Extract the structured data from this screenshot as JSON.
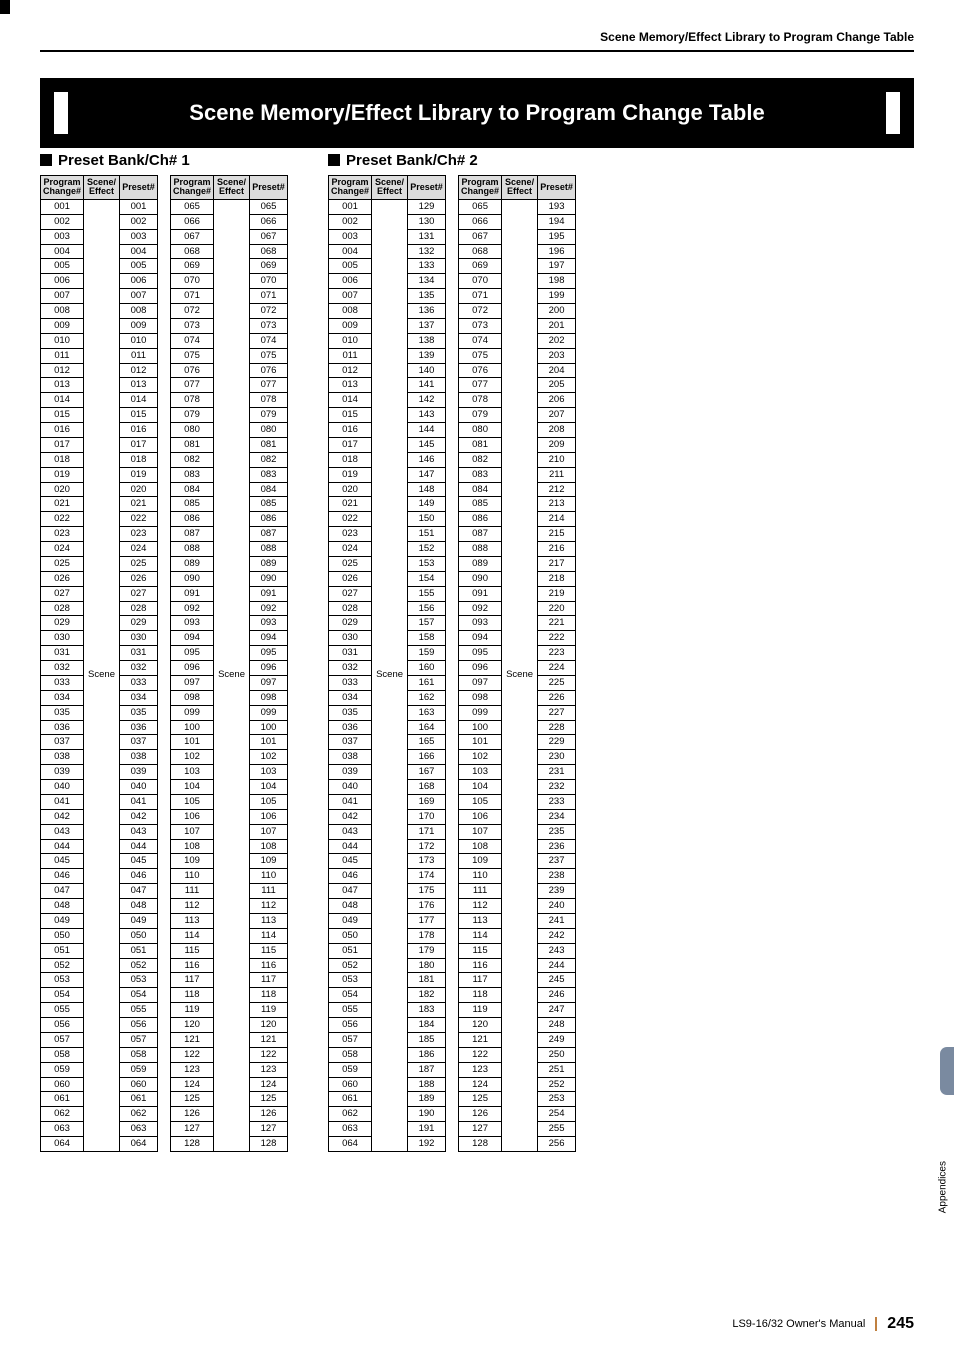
{
  "running_head": "Scene Memory/Effect Library to Program Change Table",
  "title": "Scene Memory/Effect Library to Program Change Table",
  "scene_label": "Scene",
  "headers": {
    "program_change": [
      "Program",
      "Change#"
    ],
    "scene_effect": [
      "Scene/",
      "Effect"
    ],
    "preset": "Preset#"
  },
  "bank1": {
    "heading": "Preset Bank/Ch# 1",
    "tableA": {
      "rows": [
        {
          "pc": "001",
          "preset": "001"
        },
        {
          "pc": "002",
          "preset": "002"
        },
        {
          "pc": "003",
          "preset": "003"
        },
        {
          "pc": "004",
          "preset": "004"
        },
        {
          "pc": "005",
          "preset": "005"
        },
        {
          "pc": "006",
          "preset": "006"
        },
        {
          "pc": "007",
          "preset": "007"
        },
        {
          "pc": "008",
          "preset": "008"
        },
        {
          "pc": "009",
          "preset": "009"
        },
        {
          "pc": "010",
          "preset": "010"
        },
        {
          "pc": "011",
          "preset": "011"
        },
        {
          "pc": "012",
          "preset": "012"
        },
        {
          "pc": "013",
          "preset": "013"
        },
        {
          "pc": "014",
          "preset": "014"
        },
        {
          "pc": "015",
          "preset": "015"
        },
        {
          "pc": "016",
          "preset": "016"
        },
        {
          "pc": "017",
          "preset": "017"
        },
        {
          "pc": "018",
          "preset": "018"
        },
        {
          "pc": "019",
          "preset": "019"
        },
        {
          "pc": "020",
          "preset": "020"
        },
        {
          "pc": "021",
          "preset": "021"
        },
        {
          "pc": "022",
          "preset": "022"
        },
        {
          "pc": "023",
          "preset": "023"
        },
        {
          "pc": "024",
          "preset": "024"
        },
        {
          "pc": "025",
          "preset": "025"
        },
        {
          "pc": "026",
          "preset": "026"
        },
        {
          "pc": "027",
          "preset": "027"
        },
        {
          "pc": "028",
          "preset": "028"
        },
        {
          "pc": "029",
          "preset": "029"
        },
        {
          "pc": "030",
          "preset": "030"
        },
        {
          "pc": "031",
          "preset": "031"
        },
        {
          "pc": "032",
          "preset": "032"
        },
        {
          "pc": "033",
          "preset": "033"
        },
        {
          "pc": "034",
          "preset": "034"
        },
        {
          "pc": "035",
          "preset": "035"
        },
        {
          "pc": "036",
          "preset": "036"
        },
        {
          "pc": "037",
          "preset": "037"
        },
        {
          "pc": "038",
          "preset": "038"
        },
        {
          "pc": "039",
          "preset": "039"
        },
        {
          "pc": "040",
          "preset": "040"
        },
        {
          "pc": "041",
          "preset": "041"
        },
        {
          "pc": "042",
          "preset": "042"
        },
        {
          "pc": "043",
          "preset": "043"
        },
        {
          "pc": "044",
          "preset": "044"
        },
        {
          "pc": "045",
          "preset": "045"
        },
        {
          "pc": "046",
          "preset": "046"
        },
        {
          "pc": "047",
          "preset": "047"
        },
        {
          "pc": "048",
          "preset": "048"
        },
        {
          "pc": "049",
          "preset": "049"
        },
        {
          "pc": "050",
          "preset": "050"
        },
        {
          "pc": "051",
          "preset": "051"
        },
        {
          "pc": "052",
          "preset": "052"
        },
        {
          "pc": "053",
          "preset": "053"
        },
        {
          "pc": "054",
          "preset": "054"
        },
        {
          "pc": "055",
          "preset": "055"
        },
        {
          "pc": "056",
          "preset": "056"
        },
        {
          "pc": "057",
          "preset": "057"
        },
        {
          "pc": "058",
          "preset": "058"
        },
        {
          "pc": "059",
          "preset": "059"
        },
        {
          "pc": "060",
          "preset": "060"
        },
        {
          "pc": "061",
          "preset": "061"
        },
        {
          "pc": "062",
          "preset": "062"
        },
        {
          "pc": "063",
          "preset": "063"
        },
        {
          "pc": "064",
          "preset": "064"
        }
      ]
    },
    "tableB": {
      "rows": [
        {
          "pc": "065",
          "preset": "065"
        },
        {
          "pc": "066",
          "preset": "066"
        },
        {
          "pc": "067",
          "preset": "067"
        },
        {
          "pc": "068",
          "preset": "068"
        },
        {
          "pc": "069",
          "preset": "069"
        },
        {
          "pc": "070",
          "preset": "070"
        },
        {
          "pc": "071",
          "preset": "071"
        },
        {
          "pc": "072",
          "preset": "072"
        },
        {
          "pc": "073",
          "preset": "073"
        },
        {
          "pc": "074",
          "preset": "074"
        },
        {
          "pc": "075",
          "preset": "075"
        },
        {
          "pc": "076",
          "preset": "076"
        },
        {
          "pc": "077",
          "preset": "077"
        },
        {
          "pc": "078",
          "preset": "078"
        },
        {
          "pc": "079",
          "preset": "079"
        },
        {
          "pc": "080",
          "preset": "080"
        },
        {
          "pc": "081",
          "preset": "081"
        },
        {
          "pc": "082",
          "preset": "082"
        },
        {
          "pc": "083",
          "preset": "083"
        },
        {
          "pc": "084",
          "preset": "084"
        },
        {
          "pc": "085",
          "preset": "085"
        },
        {
          "pc": "086",
          "preset": "086"
        },
        {
          "pc": "087",
          "preset": "087"
        },
        {
          "pc": "088",
          "preset": "088"
        },
        {
          "pc": "089",
          "preset": "089"
        },
        {
          "pc": "090",
          "preset": "090"
        },
        {
          "pc": "091",
          "preset": "091"
        },
        {
          "pc": "092",
          "preset": "092"
        },
        {
          "pc": "093",
          "preset": "093"
        },
        {
          "pc": "094",
          "preset": "094"
        },
        {
          "pc": "095",
          "preset": "095"
        },
        {
          "pc": "096",
          "preset": "096"
        },
        {
          "pc": "097",
          "preset": "097"
        },
        {
          "pc": "098",
          "preset": "098"
        },
        {
          "pc": "099",
          "preset": "099"
        },
        {
          "pc": "100",
          "preset": "100"
        },
        {
          "pc": "101",
          "preset": "101"
        },
        {
          "pc": "102",
          "preset": "102"
        },
        {
          "pc": "103",
          "preset": "103"
        },
        {
          "pc": "104",
          "preset": "104"
        },
        {
          "pc": "105",
          "preset": "105"
        },
        {
          "pc": "106",
          "preset": "106"
        },
        {
          "pc": "107",
          "preset": "107"
        },
        {
          "pc": "108",
          "preset": "108"
        },
        {
          "pc": "109",
          "preset": "109"
        },
        {
          "pc": "110",
          "preset": "110"
        },
        {
          "pc": "111",
          "preset": "111"
        },
        {
          "pc": "112",
          "preset": "112"
        },
        {
          "pc": "113",
          "preset": "113"
        },
        {
          "pc": "114",
          "preset": "114"
        },
        {
          "pc": "115",
          "preset": "115"
        },
        {
          "pc": "116",
          "preset": "116"
        },
        {
          "pc": "117",
          "preset": "117"
        },
        {
          "pc": "118",
          "preset": "118"
        },
        {
          "pc": "119",
          "preset": "119"
        },
        {
          "pc": "120",
          "preset": "120"
        },
        {
          "pc": "121",
          "preset": "121"
        },
        {
          "pc": "122",
          "preset": "122"
        },
        {
          "pc": "123",
          "preset": "123"
        },
        {
          "pc": "124",
          "preset": "124"
        },
        {
          "pc": "125",
          "preset": "125"
        },
        {
          "pc": "126",
          "preset": "126"
        },
        {
          "pc": "127",
          "preset": "127"
        },
        {
          "pc": "128",
          "preset": "128"
        }
      ]
    }
  },
  "bank2": {
    "heading": "Preset Bank/Ch# 2",
    "tableA": {
      "rows": [
        {
          "pc": "001",
          "preset": "129"
        },
        {
          "pc": "002",
          "preset": "130"
        },
        {
          "pc": "003",
          "preset": "131"
        },
        {
          "pc": "004",
          "preset": "132"
        },
        {
          "pc": "005",
          "preset": "133"
        },
        {
          "pc": "006",
          "preset": "134"
        },
        {
          "pc": "007",
          "preset": "135"
        },
        {
          "pc": "008",
          "preset": "136"
        },
        {
          "pc": "009",
          "preset": "137"
        },
        {
          "pc": "010",
          "preset": "138"
        },
        {
          "pc": "011",
          "preset": "139"
        },
        {
          "pc": "012",
          "preset": "140"
        },
        {
          "pc": "013",
          "preset": "141"
        },
        {
          "pc": "014",
          "preset": "142"
        },
        {
          "pc": "015",
          "preset": "143"
        },
        {
          "pc": "016",
          "preset": "144"
        },
        {
          "pc": "017",
          "preset": "145"
        },
        {
          "pc": "018",
          "preset": "146"
        },
        {
          "pc": "019",
          "preset": "147"
        },
        {
          "pc": "020",
          "preset": "148"
        },
        {
          "pc": "021",
          "preset": "149"
        },
        {
          "pc": "022",
          "preset": "150"
        },
        {
          "pc": "023",
          "preset": "151"
        },
        {
          "pc": "024",
          "preset": "152"
        },
        {
          "pc": "025",
          "preset": "153"
        },
        {
          "pc": "026",
          "preset": "154"
        },
        {
          "pc": "027",
          "preset": "155"
        },
        {
          "pc": "028",
          "preset": "156"
        },
        {
          "pc": "029",
          "preset": "157"
        },
        {
          "pc": "030",
          "preset": "158"
        },
        {
          "pc": "031",
          "preset": "159"
        },
        {
          "pc": "032",
          "preset": "160"
        },
        {
          "pc": "033",
          "preset": "161"
        },
        {
          "pc": "034",
          "preset": "162"
        },
        {
          "pc": "035",
          "preset": "163"
        },
        {
          "pc": "036",
          "preset": "164"
        },
        {
          "pc": "037",
          "preset": "165"
        },
        {
          "pc": "038",
          "preset": "166"
        },
        {
          "pc": "039",
          "preset": "167"
        },
        {
          "pc": "040",
          "preset": "168"
        },
        {
          "pc": "041",
          "preset": "169"
        },
        {
          "pc": "042",
          "preset": "170"
        },
        {
          "pc": "043",
          "preset": "171"
        },
        {
          "pc": "044",
          "preset": "172"
        },
        {
          "pc": "045",
          "preset": "173"
        },
        {
          "pc": "046",
          "preset": "174"
        },
        {
          "pc": "047",
          "preset": "175"
        },
        {
          "pc": "048",
          "preset": "176"
        },
        {
          "pc": "049",
          "preset": "177"
        },
        {
          "pc": "050",
          "preset": "178"
        },
        {
          "pc": "051",
          "preset": "179"
        },
        {
          "pc": "052",
          "preset": "180"
        },
        {
          "pc": "053",
          "preset": "181"
        },
        {
          "pc": "054",
          "preset": "182"
        },
        {
          "pc": "055",
          "preset": "183"
        },
        {
          "pc": "056",
          "preset": "184"
        },
        {
          "pc": "057",
          "preset": "185"
        },
        {
          "pc": "058",
          "preset": "186"
        },
        {
          "pc": "059",
          "preset": "187"
        },
        {
          "pc": "060",
          "preset": "188"
        },
        {
          "pc": "061",
          "preset": "189"
        },
        {
          "pc": "062",
          "preset": "190"
        },
        {
          "pc": "063",
          "preset": "191"
        },
        {
          "pc": "064",
          "preset": "192"
        }
      ]
    },
    "tableB": {
      "rows": [
        {
          "pc": "065",
          "preset": "193"
        },
        {
          "pc": "066",
          "preset": "194"
        },
        {
          "pc": "067",
          "preset": "195"
        },
        {
          "pc": "068",
          "preset": "196"
        },
        {
          "pc": "069",
          "preset": "197"
        },
        {
          "pc": "070",
          "preset": "198"
        },
        {
          "pc": "071",
          "preset": "199"
        },
        {
          "pc": "072",
          "preset": "200"
        },
        {
          "pc": "073",
          "preset": "201"
        },
        {
          "pc": "074",
          "preset": "202"
        },
        {
          "pc": "075",
          "preset": "203"
        },
        {
          "pc": "076",
          "preset": "204"
        },
        {
          "pc": "077",
          "preset": "205"
        },
        {
          "pc": "078",
          "preset": "206"
        },
        {
          "pc": "079",
          "preset": "207"
        },
        {
          "pc": "080",
          "preset": "208"
        },
        {
          "pc": "081",
          "preset": "209"
        },
        {
          "pc": "082",
          "preset": "210"
        },
        {
          "pc": "083",
          "preset": "211"
        },
        {
          "pc": "084",
          "preset": "212"
        },
        {
          "pc": "085",
          "preset": "213"
        },
        {
          "pc": "086",
          "preset": "214"
        },
        {
          "pc": "087",
          "preset": "215"
        },
        {
          "pc": "088",
          "preset": "216"
        },
        {
          "pc": "089",
          "preset": "217"
        },
        {
          "pc": "090",
          "preset": "218"
        },
        {
          "pc": "091",
          "preset": "219"
        },
        {
          "pc": "092",
          "preset": "220"
        },
        {
          "pc": "093",
          "preset": "221"
        },
        {
          "pc": "094",
          "preset": "222"
        },
        {
          "pc": "095",
          "preset": "223"
        },
        {
          "pc": "096",
          "preset": "224"
        },
        {
          "pc": "097",
          "preset": "225"
        },
        {
          "pc": "098",
          "preset": "226"
        },
        {
          "pc": "099",
          "preset": "227"
        },
        {
          "pc": "100",
          "preset": "228"
        },
        {
          "pc": "101",
          "preset": "229"
        },
        {
          "pc": "102",
          "preset": "230"
        },
        {
          "pc": "103",
          "preset": "231"
        },
        {
          "pc": "104",
          "preset": "232"
        },
        {
          "pc": "105",
          "preset": "233"
        },
        {
          "pc": "106",
          "preset": "234"
        },
        {
          "pc": "107",
          "preset": "235"
        },
        {
          "pc": "108",
          "preset": "236"
        },
        {
          "pc": "109",
          "preset": "237"
        },
        {
          "pc": "110",
          "preset": "238"
        },
        {
          "pc": "111",
          "preset": "239"
        },
        {
          "pc": "112",
          "preset": "240"
        },
        {
          "pc": "113",
          "preset": "241"
        },
        {
          "pc": "114",
          "preset": "242"
        },
        {
          "pc": "115",
          "preset": "243"
        },
        {
          "pc": "116",
          "preset": "244"
        },
        {
          "pc": "117",
          "preset": "245"
        },
        {
          "pc": "118",
          "preset": "246"
        },
        {
          "pc": "119",
          "preset": "247"
        },
        {
          "pc": "120",
          "preset": "248"
        },
        {
          "pc": "121",
          "preset": "249"
        },
        {
          "pc": "122",
          "preset": "250"
        },
        {
          "pc": "123",
          "preset": "251"
        },
        {
          "pc": "124",
          "preset": "252"
        },
        {
          "pc": "125",
          "preset": "253"
        },
        {
          "pc": "126",
          "preset": "254"
        },
        {
          "pc": "127",
          "preset": "255"
        },
        {
          "pc": "128",
          "preset": "256"
        }
      ]
    }
  },
  "side_tab": "Appendices",
  "footer": {
    "manual": "LS9-16/32  Owner's Manual",
    "page": "245"
  }
}
